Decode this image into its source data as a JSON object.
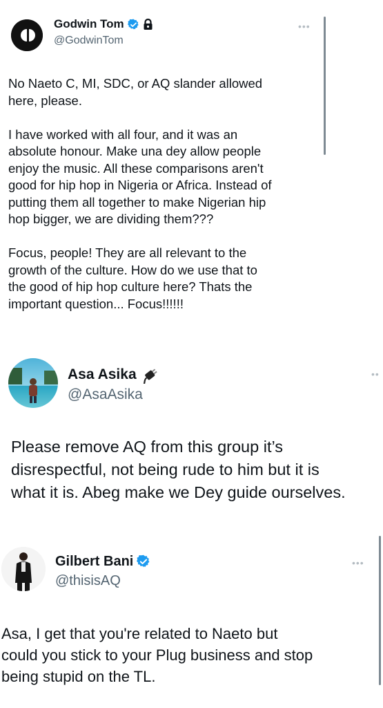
{
  "tweets": [
    {
      "author_name": "Godwin Tom",
      "author_handle": "@GodwinTom",
      "verified": true,
      "protected": true,
      "more_icon": "more-dots-icon",
      "text": "No Naeto C, MI, SDC, or AQ slander allowed\nhere, please.\n\nI have worked with all four, and it was an\nabsolute honour. Make una dey allow people\nenjoy the music. All these comparisons aren't\ngood for hip hop in Nigeria or Africa. Instead of\nputting them all together to make Nigerian hip\nhop bigger, we are dividing them???\n\nFocus, people! They are all relevant to the\ngrowth of the culture. How do we use that to\nthe good of hip hop culture here? Thats the\nimportant question... Focus!!!!!!"
    },
    {
      "author_name": "Asa Asika",
      "author_handle": "@AsaAsika",
      "badge_icon": "plug-icon",
      "more_icon": "more-dots-icon",
      "text": "Please remove AQ from this group it’s\ndisrespectful, not being rude to him but it is\nwhat it is. Abeg make we Dey guide ourselves."
    },
    {
      "author_name": "Gilbert Bani",
      "author_handle": "@thisisAQ",
      "verified": true,
      "more_icon": "more-dots-icon",
      "text": "Asa, I get that you're related to Naeto but\ncould you stick to your Plug business and stop\nbeing stupid on the TL."
    }
  ],
  "colors": {
    "text": "#0f1419",
    "secondary": "#536471",
    "verified_blue": "#1d9bf0"
  }
}
